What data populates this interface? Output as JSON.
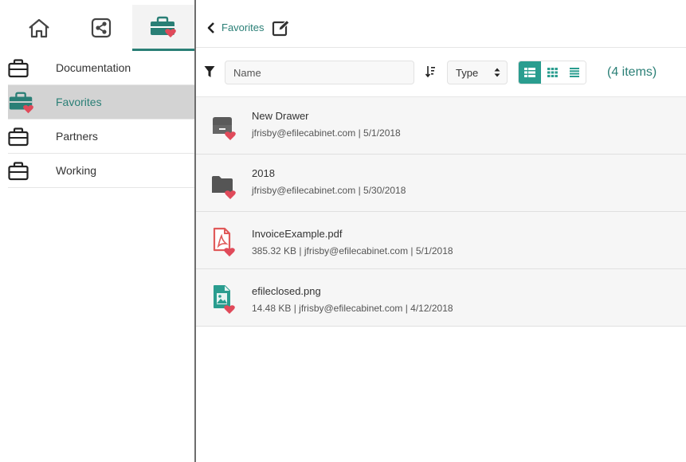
{
  "sidebar": {
    "tabs": [
      {
        "icon": "home-icon"
      },
      {
        "icon": "share-icon"
      },
      {
        "icon": "favorites-briefcase-icon"
      }
    ],
    "items": [
      {
        "label": "Documentation",
        "icon": "briefcase-icon"
      },
      {
        "label": "Favorites",
        "icon": "favorites-briefcase-icon"
      },
      {
        "label": "Partners",
        "icon": "briefcase-icon"
      },
      {
        "label": "Working",
        "icon": "briefcase-icon"
      }
    ]
  },
  "breadcrumb": {
    "label": "Favorites",
    "back_icon": "chevron-left-icon",
    "edit_icon": "edit-icon"
  },
  "toolbar": {
    "filter_icon": "filter-icon",
    "name_placeholder": "Name",
    "sort_icon": "sort-icon",
    "type_select": "Type",
    "item_count": "(4 items)"
  },
  "files": [
    {
      "name": "New Drawer",
      "meta": "jfrisby@efilecabinet.com | 5/1/2018",
      "icon": "drawer-icon"
    },
    {
      "name": "2018",
      "meta": "jfrisby@efilecabinet.com | 5/30/2018",
      "icon": "folder-icon"
    },
    {
      "name": "InvoiceExample.pdf",
      "meta": "385.32 KB | jfrisby@efilecabinet.com | 5/1/2018",
      "icon": "pdf-icon"
    },
    {
      "name": "efileclosed.png",
      "meta": "14.48 KB | jfrisby@efilecabinet.com | 4/12/2018",
      "icon": "image-file-icon"
    }
  ],
  "colors": {
    "accent": "#2a7f76",
    "heart": "#e04a5a",
    "pdf": "#e05a5a",
    "image": "#2a9d8f"
  }
}
